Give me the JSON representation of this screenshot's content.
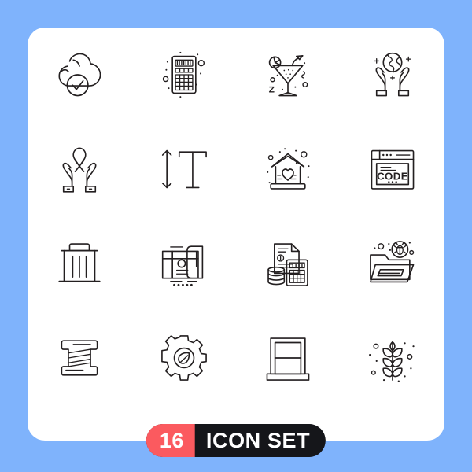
{
  "canvas": {
    "background_color": "#7fb3fc",
    "card_color": "#ffffff",
    "stroke_color": "#231f20"
  },
  "grid": {
    "columns": 4,
    "rows": 4,
    "icons": [
      {
        "name": "cloud-check-icon",
        "label": "cloud check"
      },
      {
        "name": "calculator-icon",
        "label": "calculator"
      },
      {
        "name": "cocktail-icon",
        "label": "cocktail drink"
      },
      {
        "name": "hands-globe-icon",
        "label": "hands holding globe"
      },
      {
        "name": "hands-ribbon-icon",
        "label": "hands holding awareness ribbon"
      },
      {
        "name": "text-height-icon",
        "label": "text height"
      },
      {
        "name": "house-heart-icon",
        "label": "house with heart"
      },
      {
        "name": "browser-code-icon",
        "label": "browser code window"
      },
      {
        "name": "trash-bin-icon",
        "label": "trash bin"
      },
      {
        "name": "blueprint-icon",
        "label": "blueprint document"
      },
      {
        "name": "accounting-icon",
        "label": "accounting calculator coins"
      },
      {
        "name": "folder-bug-icon",
        "label": "folder with bug"
      },
      {
        "name": "thread-spool-icon",
        "label": "thread spool"
      },
      {
        "name": "eco-gear-icon",
        "label": "gear with leaf"
      },
      {
        "name": "window-icon",
        "label": "window frame"
      },
      {
        "name": "plant-branch-icon",
        "label": "plant branch with leaves"
      }
    ]
  },
  "badge": {
    "count": "16",
    "label": "ICON SET",
    "count_color": "#fb5a5f",
    "label_color": "#15161a"
  },
  "code_icon": {
    "text": "CODE"
  }
}
